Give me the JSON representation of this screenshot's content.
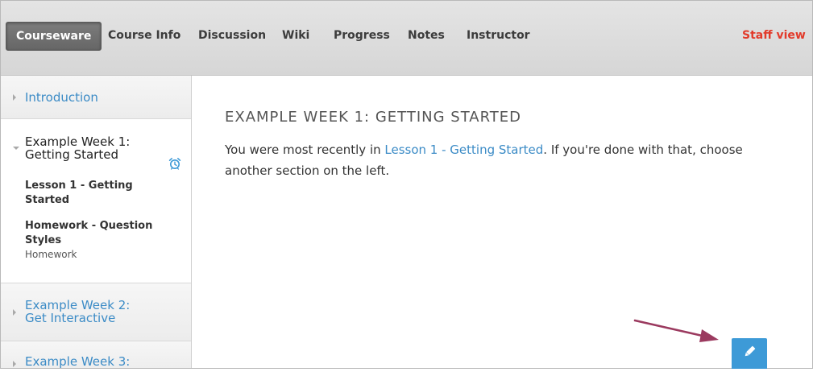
{
  "nav": {
    "tabs": [
      {
        "label": "Courseware",
        "active": true
      },
      {
        "label": "Course Info"
      },
      {
        "label": "Discussion"
      },
      {
        "label": "Wiki"
      },
      {
        "label": "Progress"
      },
      {
        "label": "Notes"
      },
      {
        "label": "Instructor"
      }
    ],
    "staff_view": "Staff view"
  },
  "sidebar": {
    "chapters": [
      {
        "title": "Introduction",
        "expanded": false
      },
      {
        "title_line1": "Example Week 1:",
        "title_line2": "Getting Started",
        "expanded": true,
        "sections": [
          {
            "line1": "Lesson 1 - Getting",
            "line2": "Started"
          },
          {
            "line1": "Homework - Question",
            "line2": "Styles",
            "subtitle": "Homework",
            "icon": "alarm-clock-icon"
          }
        ]
      },
      {
        "title_line1": "Example Week 2:",
        "title_line2": "Get Interactive",
        "expanded": false
      },
      {
        "title_line1": "Example Week 3:",
        "expanded": false
      }
    ]
  },
  "main": {
    "heading": "EXAMPLE WEEK 1: GETTING STARTED",
    "text_before": "You were most recently in ",
    "link": "Lesson 1 - Getting Started",
    "text_after": ". If you're done with that, choose another section on the left."
  },
  "colors": {
    "accent": "#3b8bc6",
    "staff": "#e23a2a",
    "edit_button": "#3d9ad7",
    "annotation_arrow": "#9b3a5f"
  },
  "annotation": {
    "icon": "annotation-arrow"
  },
  "edit_button": {
    "icon": "pencil-icon"
  }
}
